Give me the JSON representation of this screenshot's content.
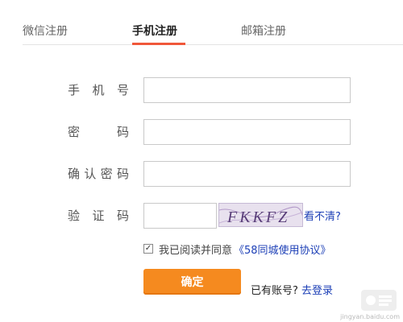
{
  "tabs": [
    {
      "label": "微信注册",
      "active": false
    },
    {
      "label": "手机注册",
      "active": true
    },
    {
      "label": "邮箱注册",
      "active": false
    }
  ],
  "form": {
    "phone": {
      "label_chars": [
        "手",
        "机",
        "号"
      ],
      "value": "",
      "placeholder": ""
    },
    "password": {
      "label_chars": [
        "密",
        "码"
      ],
      "value": "",
      "placeholder": ""
    },
    "confirm": {
      "label_chars": [
        "确",
        "认",
        "密",
        "码"
      ],
      "value": "",
      "placeholder": ""
    },
    "captcha": {
      "label_chars": [
        "验",
        "证",
        "码"
      ],
      "value": "",
      "placeholder": "",
      "image_text": "FKKFZ",
      "refresh_label": "看不清?"
    }
  },
  "agreement": {
    "checked": true,
    "text": "我已阅读并同意",
    "link": "《58同城使用协议》"
  },
  "submit_label": "确定",
  "login": {
    "prompt": "已有账号?",
    "link": "去登录"
  },
  "watermark": "jingyan.baidu.com",
  "colors": {
    "accent": "#f0573a",
    "button": "#f58a1f",
    "link": "#1c3fb6"
  }
}
